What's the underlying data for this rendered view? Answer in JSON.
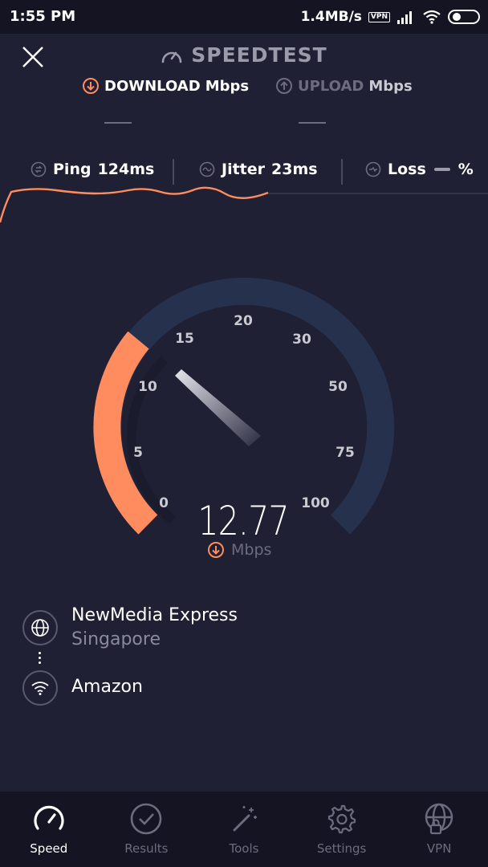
{
  "status_bar": {
    "time": "1:55 PM",
    "rate": "1.4MB/s",
    "vpn": "VPN"
  },
  "header": {
    "title": "SPEEDTEST",
    "download_label": "DOWNLOAD",
    "download_unit": "Mbps",
    "upload_label": "UPLOAD",
    "upload_unit": "Mbps"
  },
  "metrics": {
    "ping_label": "Ping",
    "ping_value": "124ms",
    "jitter_label": "Jitter",
    "jitter_value": "23ms",
    "loss_label": "Loss",
    "loss_value": "%"
  },
  "gauge": {
    "ticks": [
      "0",
      "5",
      "10",
      "15",
      "20",
      "30",
      "50",
      "75",
      "100"
    ],
    "value": "12.77",
    "unit": "Mbps"
  },
  "server": {
    "isp": "NewMedia Express",
    "location": "Singapore",
    "host": "Amazon"
  },
  "nav": [
    {
      "label": "Speed"
    },
    {
      "label": "Results"
    },
    {
      "label": "Tools"
    },
    {
      "label": "Settings"
    },
    {
      "label": "VPN"
    }
  ],
  "colors": {
    "background": "#1f2033",
    "accent": "#ff8c5f",
    "track": "#25314d",
    "muted": "#6c6c7e"
  }
}
